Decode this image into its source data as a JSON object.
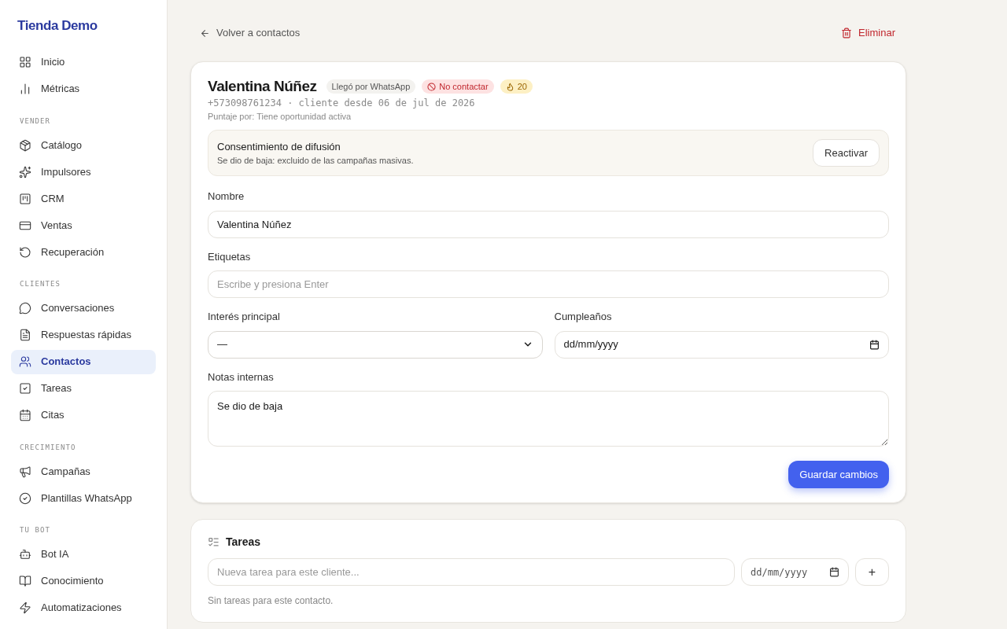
{
  "sidebar": {
    "brand": "Tienda Demo",
    "sections": [
      {
        "items": [
          {
            "label": "Inicio",
            "selected": false
          },
          {
            "label": "Métricas",
            "selected": false
          }
        ]
      },
      {
        "heading": "VENDER",
        "items": [
          {
            "label": "Catálogo",
            "selected": false
          },
          {
            "label": "Impulsores",
            "selected": false
          },
          {
            "label": "CRM",
            "selected": false
          },
          {
            "label": "Ventas",
            "selected": false
          },
          {
            "label": "Recuperación",
            "selected": false
          }
        ]
      },
      {
        "heading": "CLIENTES",
        "items": [
          {
            "label": "Conversaciones",
            "selected": false
          },
          {
            "label": "Respuestas rápidas",
            "selected": false
          },
          {
            "label": "Contactos",
            "selected": true
          },
          {
            "label": "Tareas",
            "selected": false
          },
          {
            "label": "Citas",
            "selected": false
          }
        ]
      },
      {
        "heading": "CRECIMIENTO",
        "items": [
          {
            "label": "Campañas",
            "selected": false
          },
          {
            "label": "Plantillas WhatsApp",
            "selected": false
          }
        ]
      },
      {
        "heading": "TU BOT",
        "items": [
          {
            "label": "Bot IA",
            "selected": false
          },
          {
            "label": "Conocimiento",
            "selected": false
          },
          {
            "label": "Automatizaciones",
            "selected": false
          }
        ]
      }
    ]
  },
  "top": {
    "back": "Volver a contactos",
    "delete": "Eliminar"
  },
  "contact": {
    "name": "Valentina Núñez",
    "badges": [
      {
        "kind": "source",
        "label": "Llegó por WhatsApp"
      },
      {
        "kind": "blocked",
        "label": "No contactar"
      },
      {
        "kind": "score",
        "label": "20"
      }
    ],
    "meta": "+573098761234 · cliente desde 06 de jul de 2026",
    "score_reason": "Puntaje por: Tiene oportunidad activa",
    "consent": {
      "title": "Consentimiento de difusión",
      "text": "Se dio de baja: excluido de las campañas masivas.",
      "button": "Reactivar"
    },
    "fields": {
      "name_label": "Nombre",
      "name_value": "Valentina Núñez",
      "tags_label": "Etiquetas",
      "tags_placeholder": "Escribe y presiona Enter",
      "interest_label": "Interés principal",
      "interest_value": "—",
      "birthday_label": "Cumpleaños",
      "birthday_placeholder": "dd/mm/yyyy",
      "notes_label": "Notas internas",
      "notes_value": "Se dio de baja"
    },
    "save": "Guardar cambios"
  },
  "tasks": {
    "title": "Tareas",
    "placeholder": "Nueva tarea para este cliente...",
    "date_placeholder": "dd/mm/yyyy",
    "add": "+",
    "empty": "Sin tareas para este contacto."
  }
}
